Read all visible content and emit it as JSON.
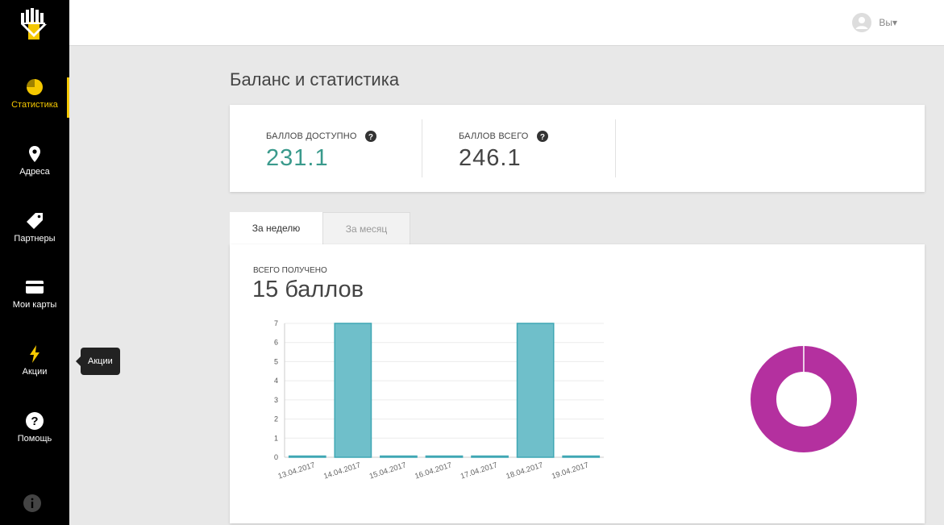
{
  "sidebar": {
    "items": [
      {
        "label": "Статистика",
        "icon": "pie-chart-icon",
        "active": true
      },
      {
        "label": "Адреса",
        "icon": "map-pin-icon",
        "active": false
      },
      {
        "label": "Партнеры",
        "icon": "tag-icon",
        "active": false
      },
      {
        "label": "Мои карты",
        "icon": "credit-card-icon",
        "active": false
      },
      {
        "label": "Акции",
        "icon": "lightning-icon",
        "active": false
      },
      {
        "label": "Помощь",
        "icon": "help-icon",
        "active": false
      }
    ],
    "tooltip": "Акции",
    "accent": "#f5c800"
  },
  "header": {
    "user": "Вы▾"
  },
  "page": {
    "title": "Баланс и статистика"
  },
  "balance": {
    "available_label": "БАЛЛОВ ДОСТУПНО",
    "available_value": "231.1",
    "total_label": "БАЛЛОВ ВСЕГО",
    "total_value": "246.1"
  },
  "tabs": [
    {
      "label": "За неделю",
      "active": true
    },
    {
      "label": "За месяц",
      "active": false
    }
  ],
  "stats": {
    "total_label": "ВСЕГО ПОЛУЧЕНО",
    "total_value": "15 баллов"
  },
  "chart_data": [
    {
      "type": "bar",
      "categories": [
        "13.04.2017",
        "14.04.2017",
        "15.04.2017",
        "16.04.2017",
        "17.04.2017",
        "18.04.2017",
        "19.04.2017"
      ],
      "values": [
        0,
        7,
        0,
        0,
        0,
        7,
        0
      ],
      "ylim": [
        0,
        7
      ],
      "yticks": [
        0,
        1,
        2,
        3,
        4,
        5,
        6,
        7
      ],
      "grid": true,
      "color": "#6fbfca",
      "border": "#3fa7b4"
    },
    {
      "type": "pie",
      "variant": "donut",
      "values": [
        1
      ],
      "colors": [
        "#b4309f"
      ]
    }
  ]
}
